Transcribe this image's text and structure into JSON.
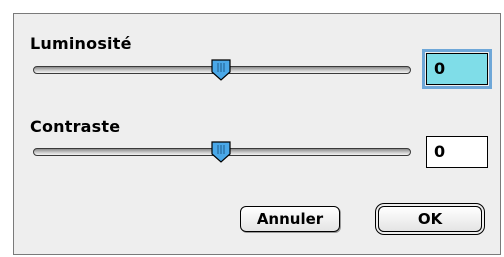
{
  "brightness": {
    "label": "Luminosité",
    "value": "0",
    "slider_position_fraction": 0.5
  },
  "contrast": {
    "label": "Contraste",
    "value": "0",
    "slider_position_fraction": 0.5
  },
  "buttons": {
    "cancel_label": "Annuler",
    "ok_label": "OK"
  },
  "colors": {
    "field_focus": "#7fdde8",
    "thumb": "#4aa8e8"
  }
}
